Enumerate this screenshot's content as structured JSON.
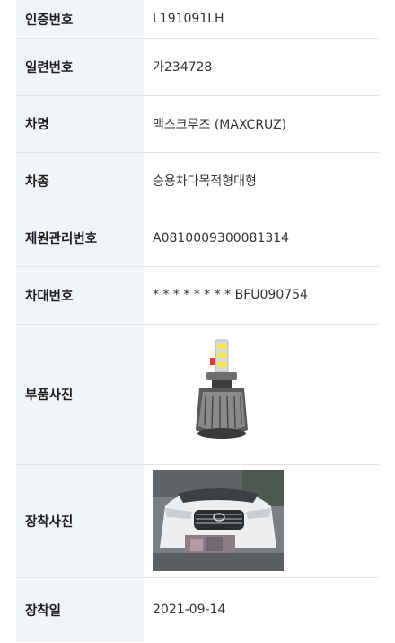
{
  "rows": [
    {
      "label": "인증번호",
      "value": "L191091LH"
    },
    {
      "label": "일련번호",
      "value": "가234728"
    },
    {
      "label": "차명",
      "value": "맥스크루즈 (MAXCRUZ)"
    },
    {
      "label": "차종",
      "value": "승용차다목적형대형"
    },
    {
      "label": "제원관리번호",
      "value": "A0810009300081314"
    },
    {
      "label": "차대번호",
      "value": "* * * * * * * * BFU090754"
    },
    {
      "label": "부품사진",
      "image_icon": "led-headlight-bulb-photo"
    },
    {
      "label": "장착사진",
      "image_icon": "car-installation-photo"
    },
    {
      "label": "장착일",
      "value": "2021-09-14"
    }
  ],
  "colors": {
    "label_bg": "#f1f4f8",
    "border": "#e3e3e3",
    "text": "#333333"
  }
}
